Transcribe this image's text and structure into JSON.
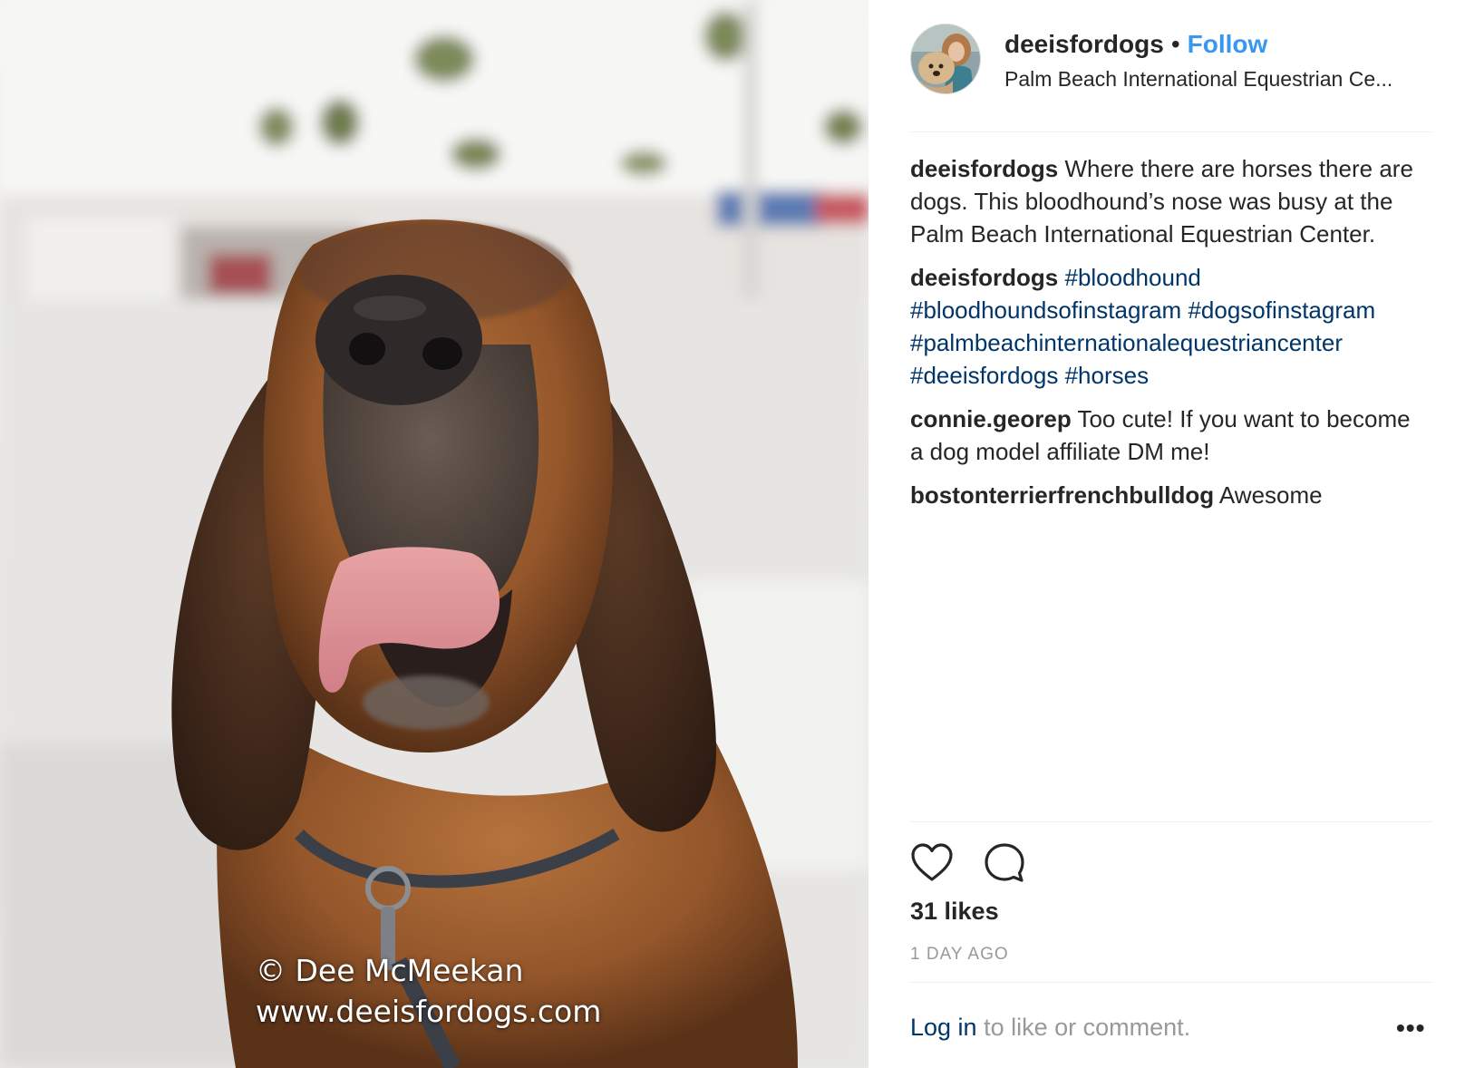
{
  "photo": {
    "watermark_line1": "© Dee McMeekan",
    "watermark_line2": "www.deeisfordogs.com"
  },
  "header": {
    "username": "deeisfordogs",
    "separator": "•",
    "follow_label": "Follow",
    "location": "Palm Beach International Equestrian Ce..."
  },
  "comments": [
    {
      "user": "deeisfordogs",
      "text": "Where there are horses there are dogs. This bloodhound’s nose was busy at the Palm Beach International Equestrian Center."
    },
    {
      "user": "deeisfordogs",
      "hashtags": [
        "#bloodhound",
        "#bloodhoundsofinstagram",
        "#dogsofinstagram",
        "#palmbeachinternationalequestriancenter",
        "#deeisfordogs",
        "#horses"
      ]
    },
    {
      "user": "connie.georep",
      "text": "Too cute! If you want to become a dog model affiliate DM me!"
    },
    {
      "user": "bostonterrierfrenchbulldog",
      "text": "Awesome"
    }
  ],
  "actions": {
    "like_icon": "heart-icon",
    "comment_icon": "comment-bubble-icon"
  },
  "likes": "31 likes",
  "time_ago": "1 DAY AGO",
  "footer": {
    "login_link": "Log in",
    "login_text": " to like or comment.",
    "more_label": "•••"
  },
  "colors": {
    "follow": "#3897f0",
    "hashtag": "#003569",
    "muted": "#999999",
    "text": "#262626"
  }
}
